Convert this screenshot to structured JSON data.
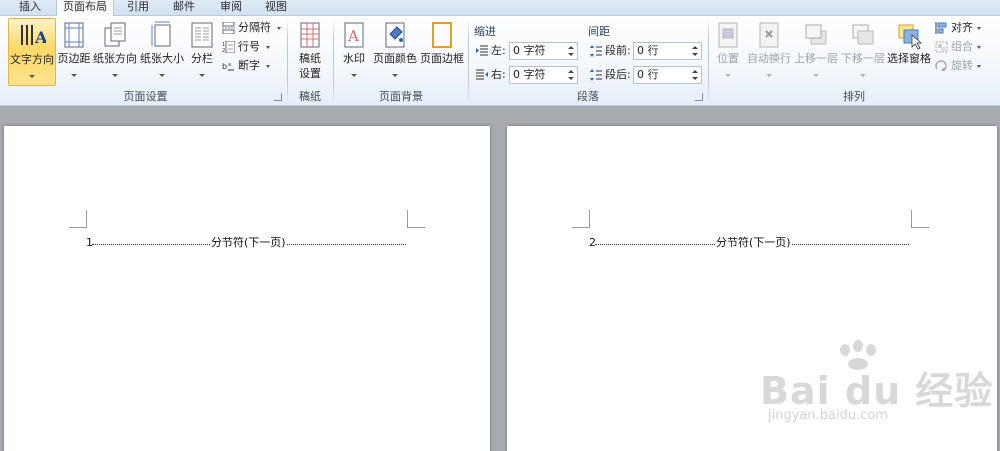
{
  "tabs": [
    {
      "label": "插入",
      "active": false
    },
    {
      "label": "页面布局",
      "active": true
    },
    {
      "label": "引用",
      "active": false
    },
    {
      "label": "邮件",
      "active": false
    },
    {
      "label": "审阅",
      "active": false
    },
    {
      "label": "视图",
      "active": false
    }
  ],
  "groups": {
    "page_setup": {
      "label": "页面设置",
      "text_direction": "文字方向",
      "margins": "页边距",
      "orientation": "纸张方向",
      "size": "纸张大小",
      "columns": "分栏",
      "breaks": "分隔符",
      "line_numbers": "行号",
      "hyphenation": "断字"
    },
    "draft_paper": {
      "label": "稿纸",
      "settings_line1": "稿纸",
      "settings_line2": "设置"
    },
    "page_background": {
      "label": "页面背景",
      "watermark": "水印",
      "page_color": "页面颜色",
      "page_borders": "页面边框"
    },
    "paragraph": {
      "label": "段落",
      "indent_title": "缩进",
      "spacing_title": "间距",
      "left_label": "左:",
      "left_value": "0 字符",
      "right_label": "右:",
      "right_value": "0 字符",
      "before_label": "段前:",
      "before_value": "0 行",
      "after_label": "段后:",
      "after_value": "0 行"
    },
    "arrange": {
      "label": "排列",
      "position": "位置",
      "wrap_text": "自动换行",
      "bring_forward": "上移一层",
      "send_backward": "下移一层",
      "selection_pane": "选择窗格",
      "align": "对齐",
      "group": "组合",
      "rotate": "旋转"
    }
  },
  "pages": [
    {
      "number": "1",
      "break_label": "分节符(下一页)"
    },
    {
      "number": "2",
      "break_label": "分节符(下一页)"
    }
  ],
  "watermark": {
    "brand": "Bai du 经验",
    "url": "jingyan.baidu.com"
  },
  "colors": {
    "accent_hot": "#ffd966",
    "ribbon_bg": "#f4f8fc",
    "workspace": "#a7abb0"
  }
}
